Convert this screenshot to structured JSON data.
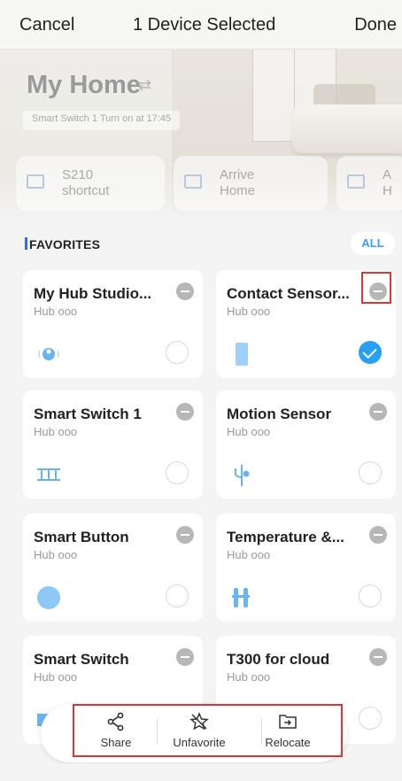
{
  "nav": {
    "cancel": "Cancel",
    "title": "1 Device Selected",
    "done": "Done"
  },
  "home": {
    "title": "My Home",
    "swap_icon": "⇄",
    "automation_text": "Smart Switch 1 Turn on at 17:45"
  },
  "shortcuts": [
    {
      "line1": "S210",
      "line2": "shortcut"
    },
    {
      "line1": "Arrive",
      "line2": "Home"
    },
    {
      "line1": "A",
      "line2": "H"
    }
  ],
  "favorites": {
    "label": "FAVORITES",
    "all_label": "ALL"
  },
  "devices": [
    {
      "name": "My Hub Studio...",
      "hub": "Hub ooo",
      "icon": "hub-device-icon",
      "selected": false
    },
    {
      "name": "Contact Sensor...",
      "hub": "Hub ooo",
      "icon": "contact-sensor-icon",
      "selected": true
    },
    {
      "name": "Smart Switch 1",
      "hub": "Hub ooo",
      "icon": "switch-icon",
      "selected": false
    },
    {
      "name": "Motion Sensor",
      "hub": "Hub ooo",
      "icon": "motion-sensor-icon",
      "selected": false
    },
    {
      "name": "Smart Button",
      "hub": "Hub ooo",
      "icon": "button-icon",
      "selected": false
    },
    {
      "name": "Temperature &...",
      "hub": "Hub ooo",
      "icon": "temperature-icon",
      "selected": false
    },
    {
      "name": "Smart Switch",
      "hub": "Hub ooo",
      "icon": "switch-icon",
      "selected": false
    },
    {
      "name": "T300 for cloud",
      "hub": "Hub ooo",
      "icon": "device-icon",
      "selected": false
    }
  ],
  "toolbar": {
    "share": "Share",
    "unfavorite": "Unfavorite",
    "relocate": "Relocate"
  },
  "colors": {
    "accent": "#27a0f4",
    "highlight": "#d33b3b",
    "favorites_bar": "#2c6fe6"
  }
}
